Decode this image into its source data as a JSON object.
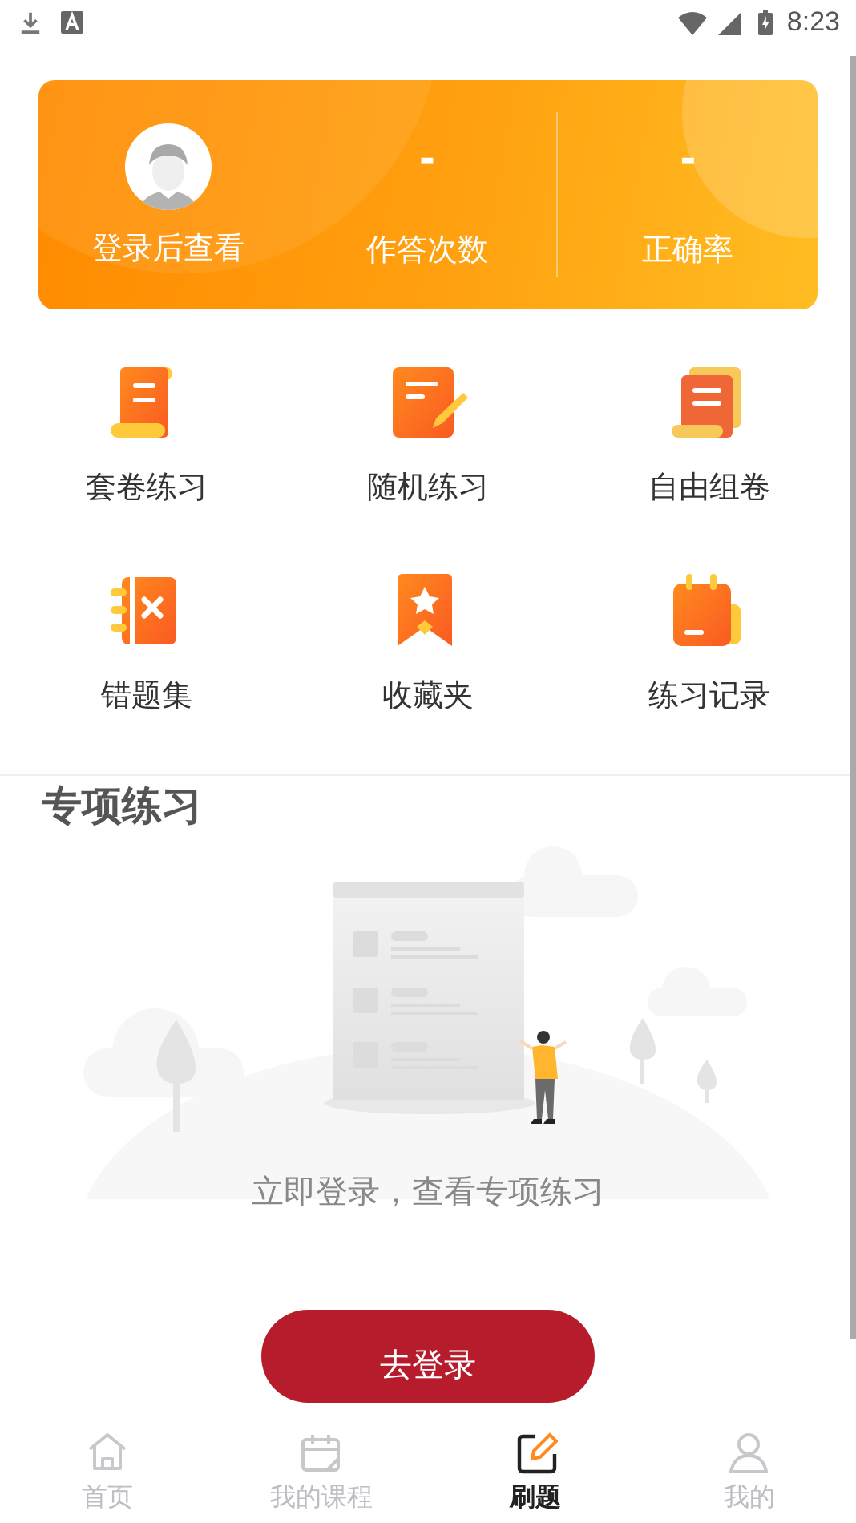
{
  "status_bar": {
    "time": "8:23"
  },
  "summary_card": {
    "login_hint": "登录后查看",
    "stats": [
      {
        "value": "-",
        "label": "作答次数"
      },
      {
        "value": "-",
        "label": "正确率"
      }
    ]
  },
  "features": [
    {
      "label": "套卷练习"
    },
    {
      "label": "随机练习"
    },
    {
      "label": "自由组卷"
    },
    {
      "label": "错题集"
    },
    {
      "label": "收藏夹"
    },
    {
      "label": "练习记录"
    }
  ],
  "section": {
    "title": "专项练习",
    "empty_message": "立即登录，查看专项练习",
    "button": "去登录"
  },
  "tabs": [
    {
      "label": "首页",
      "selected": false
    },
    {
      "label": "我的课程",
      "selected": false
    },
    {
      "label": "刷题",
      "selected": true
    },
    {
      "label": "我的",
      "selected": false
    }
  ]
}
